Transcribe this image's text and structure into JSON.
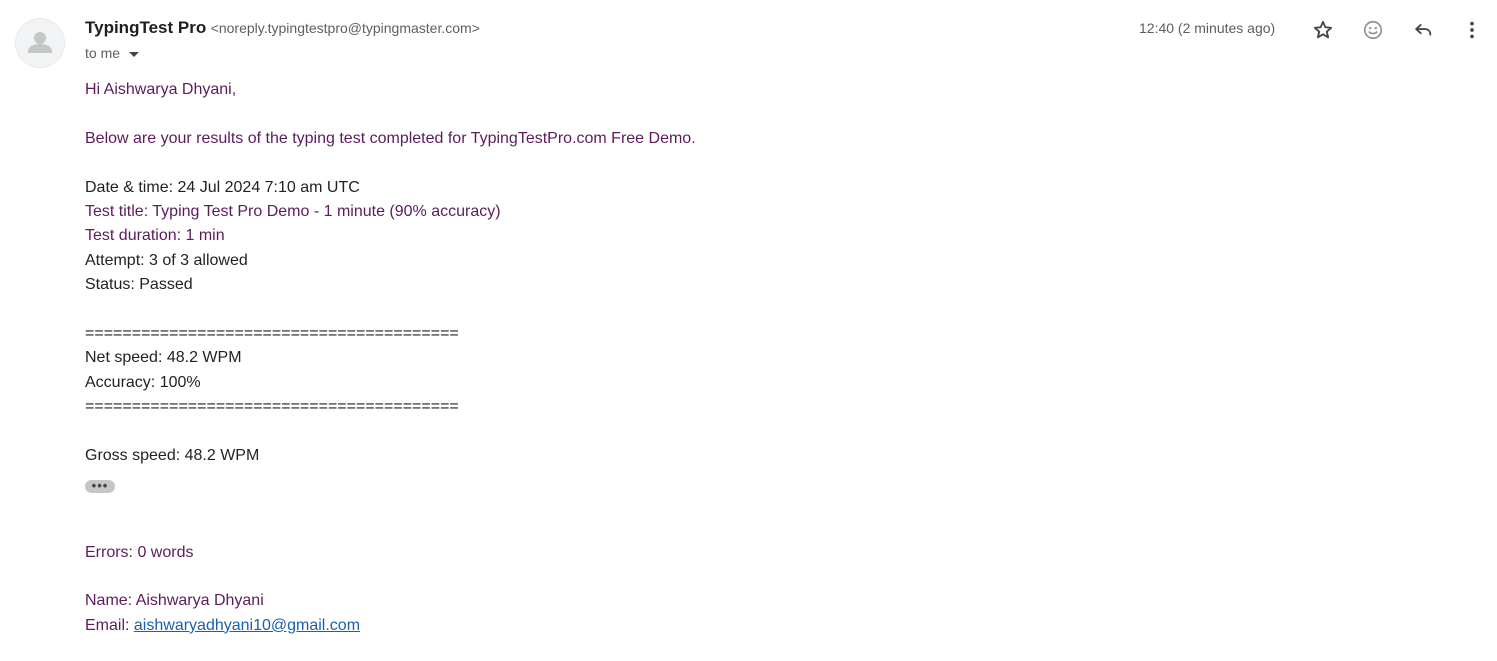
{
  "header": {
    "sender_name": "TypingTest Pro",
    "sender_email": "<noreply.typingtestpro@typingmaster.com>",
    "to_label": "to me",
    "timestamp": "12:40 (2 minutes ago)",
    "icons": [
      "star-icon",
      "emoji-icon",
      "reply-icon",
      "more-vert-icon"
    ]
  },
  "body": {
    "greeting": "Hi Aishwarya Dhyani,",
    "intro": "Below are your results of the typing test completed for TypingTestPro.com Free Demo.",
    "date_time": "Date & time: 24 Jul 2024 7:10 am UTC",
    "test_title": "Test title: Typing Test Pro Demo - 1 minute (90% accuracy)",
    "test_duration": "Test duration: 1 min",
    "attempt": "Attempt: 3 of 3 allowed",
    "status": "Status: Passed",
    "rule_top": "========================================",
    "net_speed": "Net speed: 48.2 WPM",
    "accuracy": "Accuracy: 100%",
    "rule_bottom": "========================================",
    "gross_speed": "Gross speed: 48.2 WPM",
    "show_trimmed": "•••",
    "errors": "Errors: 0 words",
    "name": "Name: Aishwarya Dhyani",
    "email_label": "Email: ",
    "email_link": "aishwaryadhyani10@gmail.com"
  },
  "colors": {
    "purple_text": "#5c1c5c",
    "link": "#1a5fb4",
    "muted": "#5e5e5e"
  }
}
